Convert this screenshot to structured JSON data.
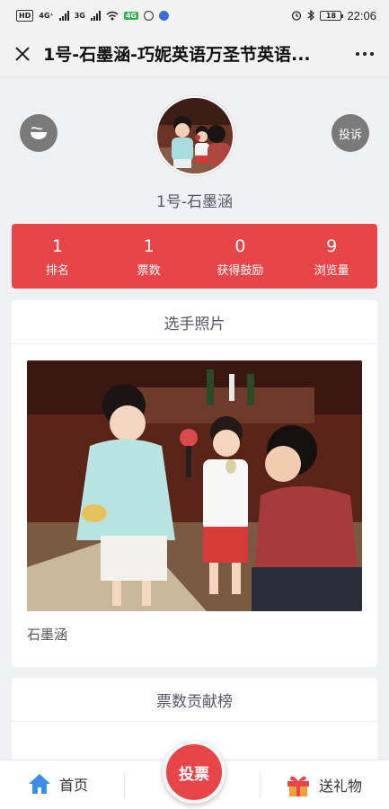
{
  "status_bar": {
    "hd_label": "HD",
    "net1": "4G⁺",
    "net2": "3G",
    "battery": "18",
    "time": "22:06"
  },
  "header": {
    "title": "1号-石墨涵-巧妮英语万圣节英语..."
  },
  "profile": {
    "complaint_label": "投诉",
    "name": "1号-石墨涵"
  },
  "stats": [
    {
      "value": "1",
      "label": "排名"
    },
    {
      "value": "1",
      "label": "票数"
    },
    {
      "value": "0",
      "label": "获得鼓励"
    },
    {
      "value": "9",
      "label": "浏览量"
    }
  ],
  "photo_section": {
    "heading": "选手照片",
    "caption": "石墨涵"
  },
  "rank_section": {
    "heading": "票数贡献榜"
  },
  "bottom_nav": {
    "home_label": "首页",
    "vote_label": "投票",
    "gift_label": "送礼物"
  },
  "colors": {
    "accent": "#e84549",
    "home_icon": "#3a8ee6",
    "gift_icon": "#f0a23a"
  }
}
